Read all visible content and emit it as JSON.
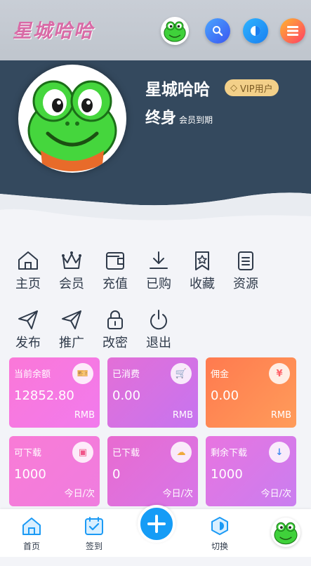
{
  "header": {
    "logo_text": "星城哈哈",
    "buttons": [
      "avatar",
      "search-icon",
      "theme-icon",
      "menu-icon"
    ]
  },
  "profile": {
    "name": "星城哈哈",
    "vip_badge": "VIP用户",
    "term": "终身",
    "term_suffix": "会员到期"
  },
  "nav": {
    "row1": [
      "主页",
      "会员",
      "充值",
      "已购",
      "收藏",
      "资源"
    ],
    "row2": [
      "发布",
      "推广",
      "改密",
      "退出"
    ]
  },
  "cards": [
    {
      "title": "当前余额",
      "value": "12852.80",
      "unit": "RMB",
      "icon": "ticket-icon",
      "icon_glyph": "🎫",
      "icon_color": "#f5b72b"
    },
    {
      "title": "已消费",
      "value": "0.00",
      "unit": "RMB",
      "icon": "cart-icon",
      "icon_glyph": "🛒",
      "icon_color": "#2a8df0"
    },
    {
      "title": "佣金",
      "value": "0.00",
      "unit": "RMB",
      "icon": "yen-icon",
      "icon_glyph": "¥",
      "icon_color": "#ff5a6b"
    },
    {
      "title": "可下载",
      "value": "1000",
      "unit": "今日/次",
      "icon": "download-box-icon",
      "icon_glyph": "▣",
      "icon_color": "#f04e7a"
    },
    {
      "title": "已下载",
      "value": "0",
      "unit": "今日/次",
      "icon": "cloud-download-icon",
      "icon_glyph": "☁",
      "icon_color": "#f3b41f"
    },
    {
      "title": "剩余下载",
      "value": "1000",
      "unit": "今日/次",
      "icon": "circle-download-icon",
      "icon_glyph": "↓",
      "icon_color": "#2a8df0"
    }
  ],
  "tabbar": {
    "home": "首页",
    "checkin": "签到",
    "switch": "切换"
  },
  "colors": {
    "hero_dark": "#34495e",
    "accent_blue": "#159cf6",
    "vip_gold": "#f3d089"
  }
}
